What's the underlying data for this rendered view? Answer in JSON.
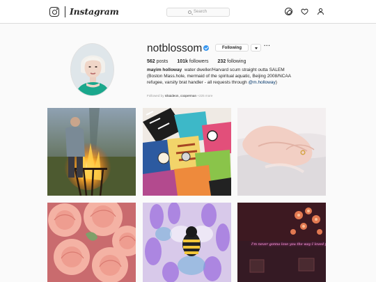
{
  "nav": {
    "brand": "Instagram",
    "search_placeholder": "Search",
    "icons": [
      "instagram-logo-icon",
      "search-icon",
      "compass-icon",
      "heart-icon",
      "user-icon"
    ]
  },
  "profile": {
    "username": "notblossom",
    "verified": true,
    "follow_button": "Following",
    "more": "···",
    "stats": {
      "posts_count": "562",
      "posts_label": "posts",
      "followers_count": "101k",
      "followers_label": "followers",
      "following_count": "232",
      "following_label": "following"
    },
    "bio": {
      "full_name": "mayim holloway",
      "text": "water dweller/Harvard scum straight outta SALEM (Boston Mass.hole, mermaid of the spiritual aquatic, Beijing 2008/NCAA refugee, varsity brat handler - all requests through",
      "mention": "@m.holloway",
      "mention_suffix": ")"
    },
    "followed_by": {
      "prefix": "Followed by",
      "names": "nikaideon, cooperman",
      "suffix": "+225 more"
    }
  },
  "posts": [
    {
      "subject": "person at bonfire"
    },
    {
      "subject": "pile of patterned fabrics"
    },
    {
      "subject": "hands with gold ring"
    },
    {
      "subject": "pink peonies"
    },
    {
      "subject": "bee on lavender"
    },
    {
      "subject": "neon sign text",
      "text": "I'm never gonna love you the way I loved you"
    }
  ],
  "colors": {
    "accent": "#3897f0",
    "border": "#dbdbdb",
    "text": "#262626",
    "muted": "#999999"
  }
}
